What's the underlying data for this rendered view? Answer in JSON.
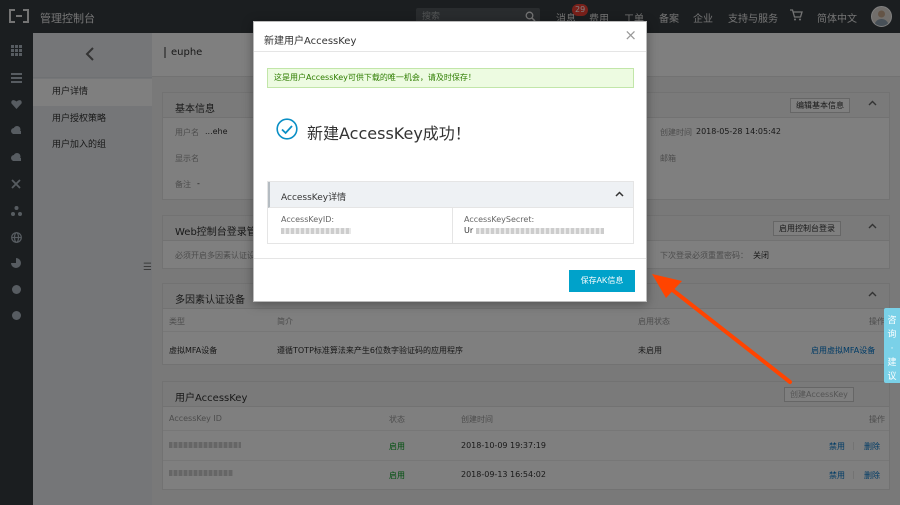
{
  "topbar": {
    "title": "管理控制台",
    "search_placeholder": "搜索",
    "messages_label": "消息",
    "messages_count": "29",
    "nav": [
      "费用",
      "工单",
      "备案",
      "企业",
      "支持与服务",
      "简体中文"
    ]
  },
  "sidebar": {
    "items": [
      "用户详情",
      "用户授权策略",
      "用户加入的组"
    ]
  },
  "breadcrumb": "euphe",
  "basic_info": {
    "title": "基本信息",
    "edit_button": "编辑基本信息",
    "username_label": "用户名",
    "username_value": "...ehe",
    "display_name_label": "显示名",
    "remark_label": "备注",
    "remark_value": "-",
    "created_label": "创建时间",
    "created_value": "2018-05-28 14:05:42",
    "email_label": "邮箱"
  },
  "web_login": {
    "title": "Web控制台登录管理",
    "enable_button": "启用控制台登录",
    "mfa_required_label": "必须开启多因素认证设",
    "reset_pwd_label": "下次登录必须重置密码：",
    "reset_pwd_value": "关闭"
  },
  "mfa": {
    "title": "多因素认证设备",
    "columns": [
      "类型",
      "简介",
      "启用状态",
      "操作"
    ],
    "row": {
      "type": "虚拟MFA设备",
      "desc": "遵循TOTP标准算法来产生6位数字验证码的应用程序",
      "status": "未启用",
      "action": "启用虚拟MFA设备"
    }
  },
  "user_ak": {
    "title": "用户AccessKey",
    "create_button": "创建AccessKey",
    "columns": [
      "AccessKey ID",
      "状态",
      "创建时间",
      "操作"
    ],
    "rows": [
      {
        "status": "启用",
        "created": "2018-10-09 19:37:19",
        "disable": "禁用",
        "delete": "删除"
      },
      {
        "status": "启用",
        "created": "2018-09-13 16:54:02",
        "disable": "禁用",
        "delete": "删除"
      }
    ]
  },
  "modal": {
    "title": "新建用户AccessKey",
    "notice": "这是用户AccessKey可供下载的唯一机会，请及时保存！",
    "success": "新建AccessKey成功！",
    "detail_title": "AccessKey详情",
    "id_label": "AccessKeyID:",
    "secret_label": "AccessKeySecret:",
    "secret_prefix": "Ur",
    "save_button": "保存AK信息"
  },
  "feedback": [
    "咨",
    "询",
    "·",
    "建",
    "议"
  ],
  "colors": {
    "topbar": "#373d41",
    "primary": "#00a2ca",
    "link": "#0077cc",
    "success": "#009f1d",
    "arrow": "#ff4400"
  },
  "icons": [
    "logo-icon",
    "search-icon",
    "cart-icon",
    "avatar",
    "grid-icon",
    "list-icon",
    "heart-icon",
    "cloud-icon",
    "cloud-up-icon",
    "tools-icon",
    "cluster-icon",
    "globe-icon",
    "pie-icon",
    "dot-icon",
    "chevron-left-icon",
    "chevron-up-icon",
    "close-icon",
    "check-circle-icon"
  ]
}
